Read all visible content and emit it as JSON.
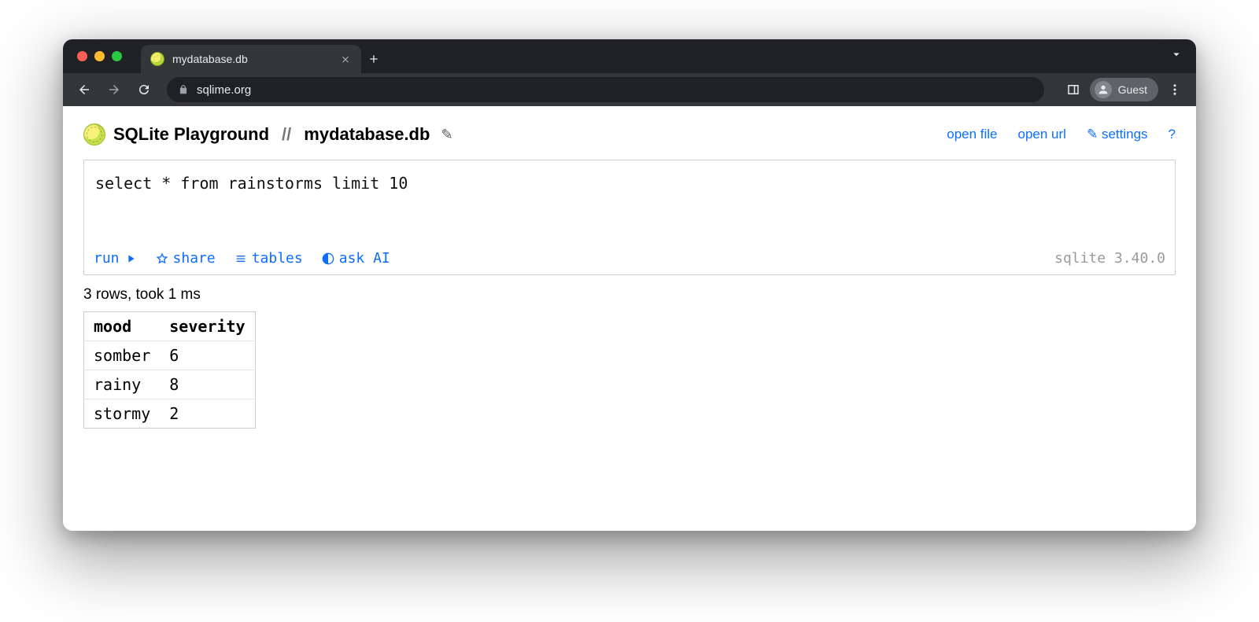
{
  "browser": {
    "tab_title": "mydatabase.db",
    "url_display": "sqlime.org",
    "guest_label": "Guest"
  },
  "header": {
    "brand": "SQLite Playground",
    "separator": "//",
    "db_name": "mydatabase.db",
    "pencil_glyph": "✎",
    "links": {
      "open_file": "open file",
      "open_url": "open url",
      "settings_glyph": "✎",
      "settings": "settings",
      "help": "?"
    }
  },
  "editor": {
    "value": "select * from rainstorms limit 10",
    "actions": {
      "run": "run",
      "share": "share",
      "tables": "tables",
      "ask_ai": "ask AI"
    },
    "version": "sqlite 3.40.0"
  },
  "status": "3 rows, took 1 ms",
  "results": {
    "columns": [
      "mood",
      "severity"
    ],
    "rows": [
      [
        "somber",
        "6"
      ],
      [
        "rainy",
        "8"
      ],
      [
        "stormy",
        "2"
      ]
    ]
  }
}
